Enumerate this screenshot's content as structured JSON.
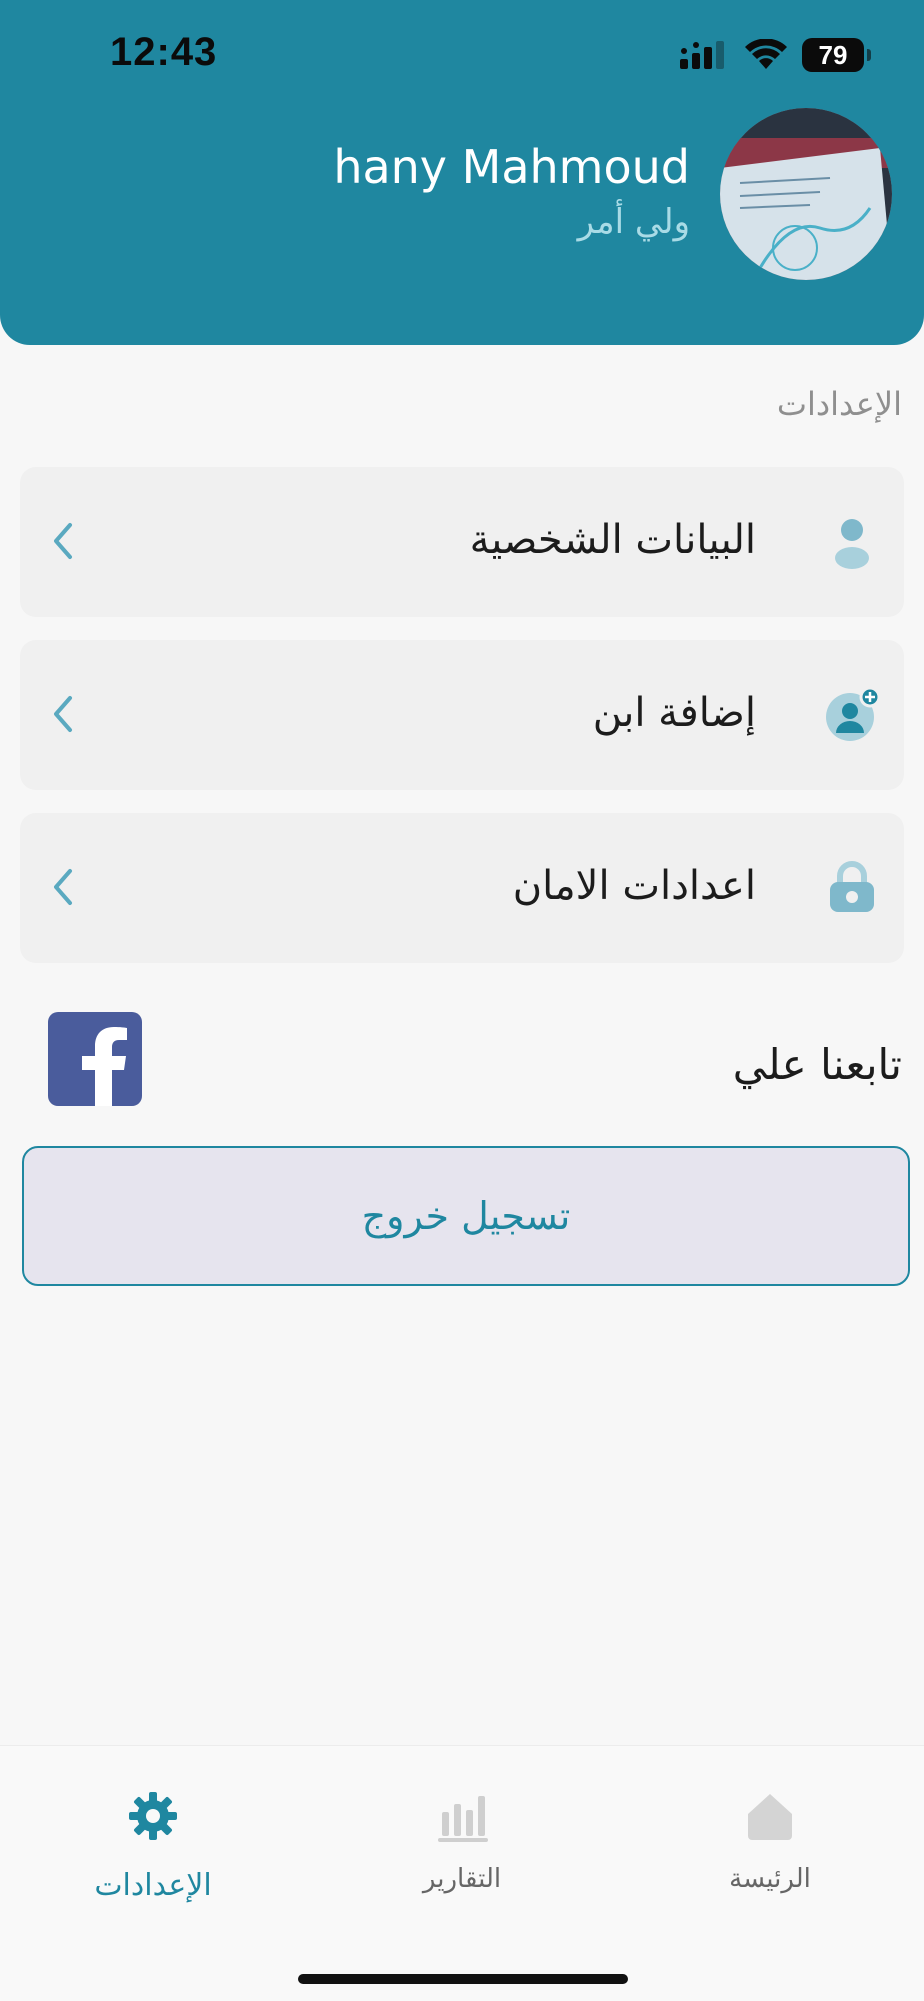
{
  "status_bar": {
    "time": "12:43",
    "battery": "79"
  },
  "profile": {
    "name": "hany Mahmoud",
    "role": "ولي أمر"
  },
  "settings": {
    "title": "الإعدادات",
    "items": [
      {
        "label": "البيانات الشخصية",
        "icon": "person-icon"
      },
      {
        "label": "إضافة ابن",
        "icon": "add-child-icon"
      },
      {
        "label": "اعدادات الامان",
        "icon": "lock-icon"
      }
    ]
  },
  "follow": {
    "label": "تابعنا علي",
    "icon": "facebook-icon"
  },
  "logout": {
    "label": "تسجيل خروج"
  },
  "bottom_nav": {
    "items": [
      {
        "label": "الإعدادات",
        "icon": "gear-icon",
        "active": true
      },
      {
        "label": "التقارير",
        "icon": "bar-chart-icon",
        "active": false
      },
      {
        "label": "الرئيسة",
        "icon": "home-icon",
        "active": false
      }
    ]
  },
  "colors": {
    "primary": "#1f87a0",
    "header_secondary_text": "#a9dbe6",
    "card_bg": "#f0f0f0",
    "logout_bg": "#e6e4ee",
    "facebook": "#4a5c9c",
    "icon_tint": "#7fb8cb"
  }
}
